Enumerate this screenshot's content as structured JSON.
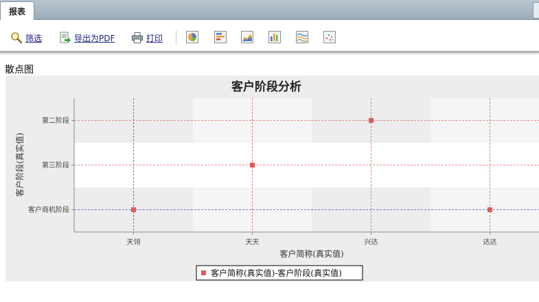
{
  "tab": {
    "label": "报表"
  },
  "toolbar": {
    "filter_label": "筛选",
    "export_pdf_label": "导出为PDF",
    "print_label": "打印",
    "chart_buttons": [
      "pie-chart-icon",
      "bar-chart-icon",
      "area-chart-icon",
      "column-chart-icon",
      "line-chart-icon",
      "scatter-chart-icon"
    ]
  },
  "section": {
    "title": "散点图"
  },
  "chart_data": {
    "type": "scatter",
    "title": "客户阶段分析",
    "xlabel": "客户简称(真实值)",
    "ylabel": "客户阶段(真实值)",
    "x_categories": [
      "天翎",
      "天天",
      "兴达",
      "达达"
    ],
    "y_categories": [
      "客户商机阶段",
      "第三阶段",
      "第二阶段"
    ],
    "series": [
      {
        "name": "客户简称(真实值)-客户阶段(真实值)",
        "color": "#e05a5a",
        "points": [
          {
            "x": "天翎",
            "y": "客户商机阶段"
          },
          {
            "x": "天天",
            "y": "第三阶段"
          },
          {
            "x": "兴达",
            "y": "第二阶段"
          },
          {
            "x": "达达",
            "y": "客户商机阶段"
          }
        ]
      }
    ],
    "grid": true,
    "legend_position": "bottom"
  }
}
